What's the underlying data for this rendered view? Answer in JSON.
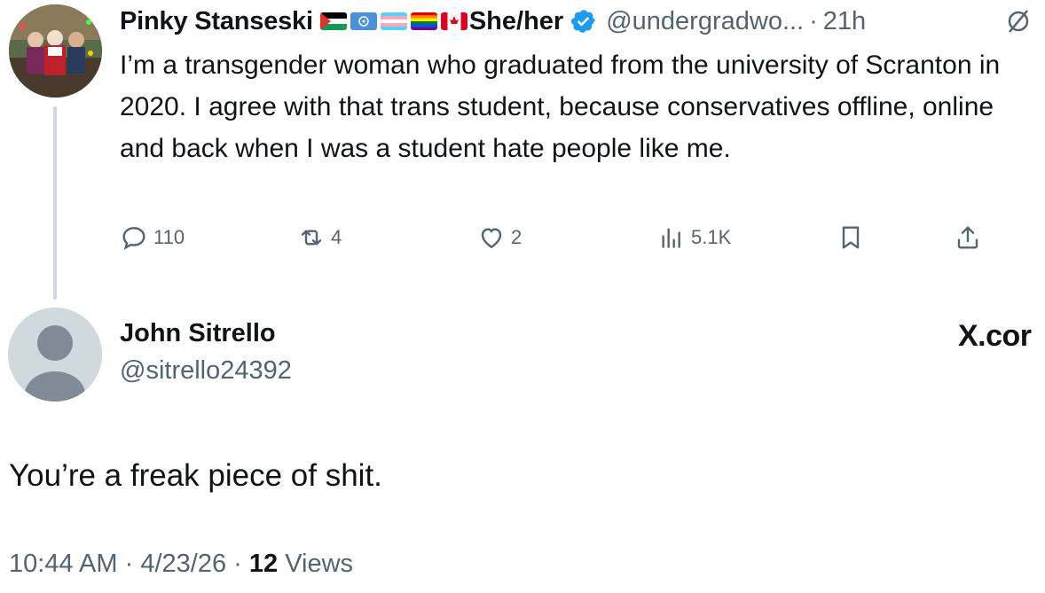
{
  "parent_tweet": {
    "display_name": "Pinky Stanseski",
    "pronouns": "She/her",
    "handle": "@undergradwo...",
    "separator": "·",
    "time_ago": "21h",
    "text": "I’m a transgender woman who graduated from the university of Scranton in 2020. I agree with that trans student, because conservatives offline, online and back when I was a student hate people like me.",
    "flags": [
      "palestine-flag",
      "united-nations-flag",
      "transgender-flag",
      "rainbow-pride-flag",
      "canada-flag"
    ],
    "actions": {
      "replies": "110",
      "reposts": "4",
      "likes": "2",
      "views": "5.1K"
    }
  },
  "reply_tweet": {
    "display_name": "John Sitrello",
    "handle": "@sitrello24392",
    "text": "You’re a freak piece of shit.",
    "time": "10:44 AM",
    "separator": "·",
    "date": "4/23/26",
    "views_count": "12",
    "views_label": "Views"
  },
  "watermark": "X.cor",
  "colors": {
    "text_primary": "#0f1419",
    "text_secondary": "#536471",
    "verified_blue": "#1d9bf0",
    "thread_line": "#cfd9de"
  }
}
